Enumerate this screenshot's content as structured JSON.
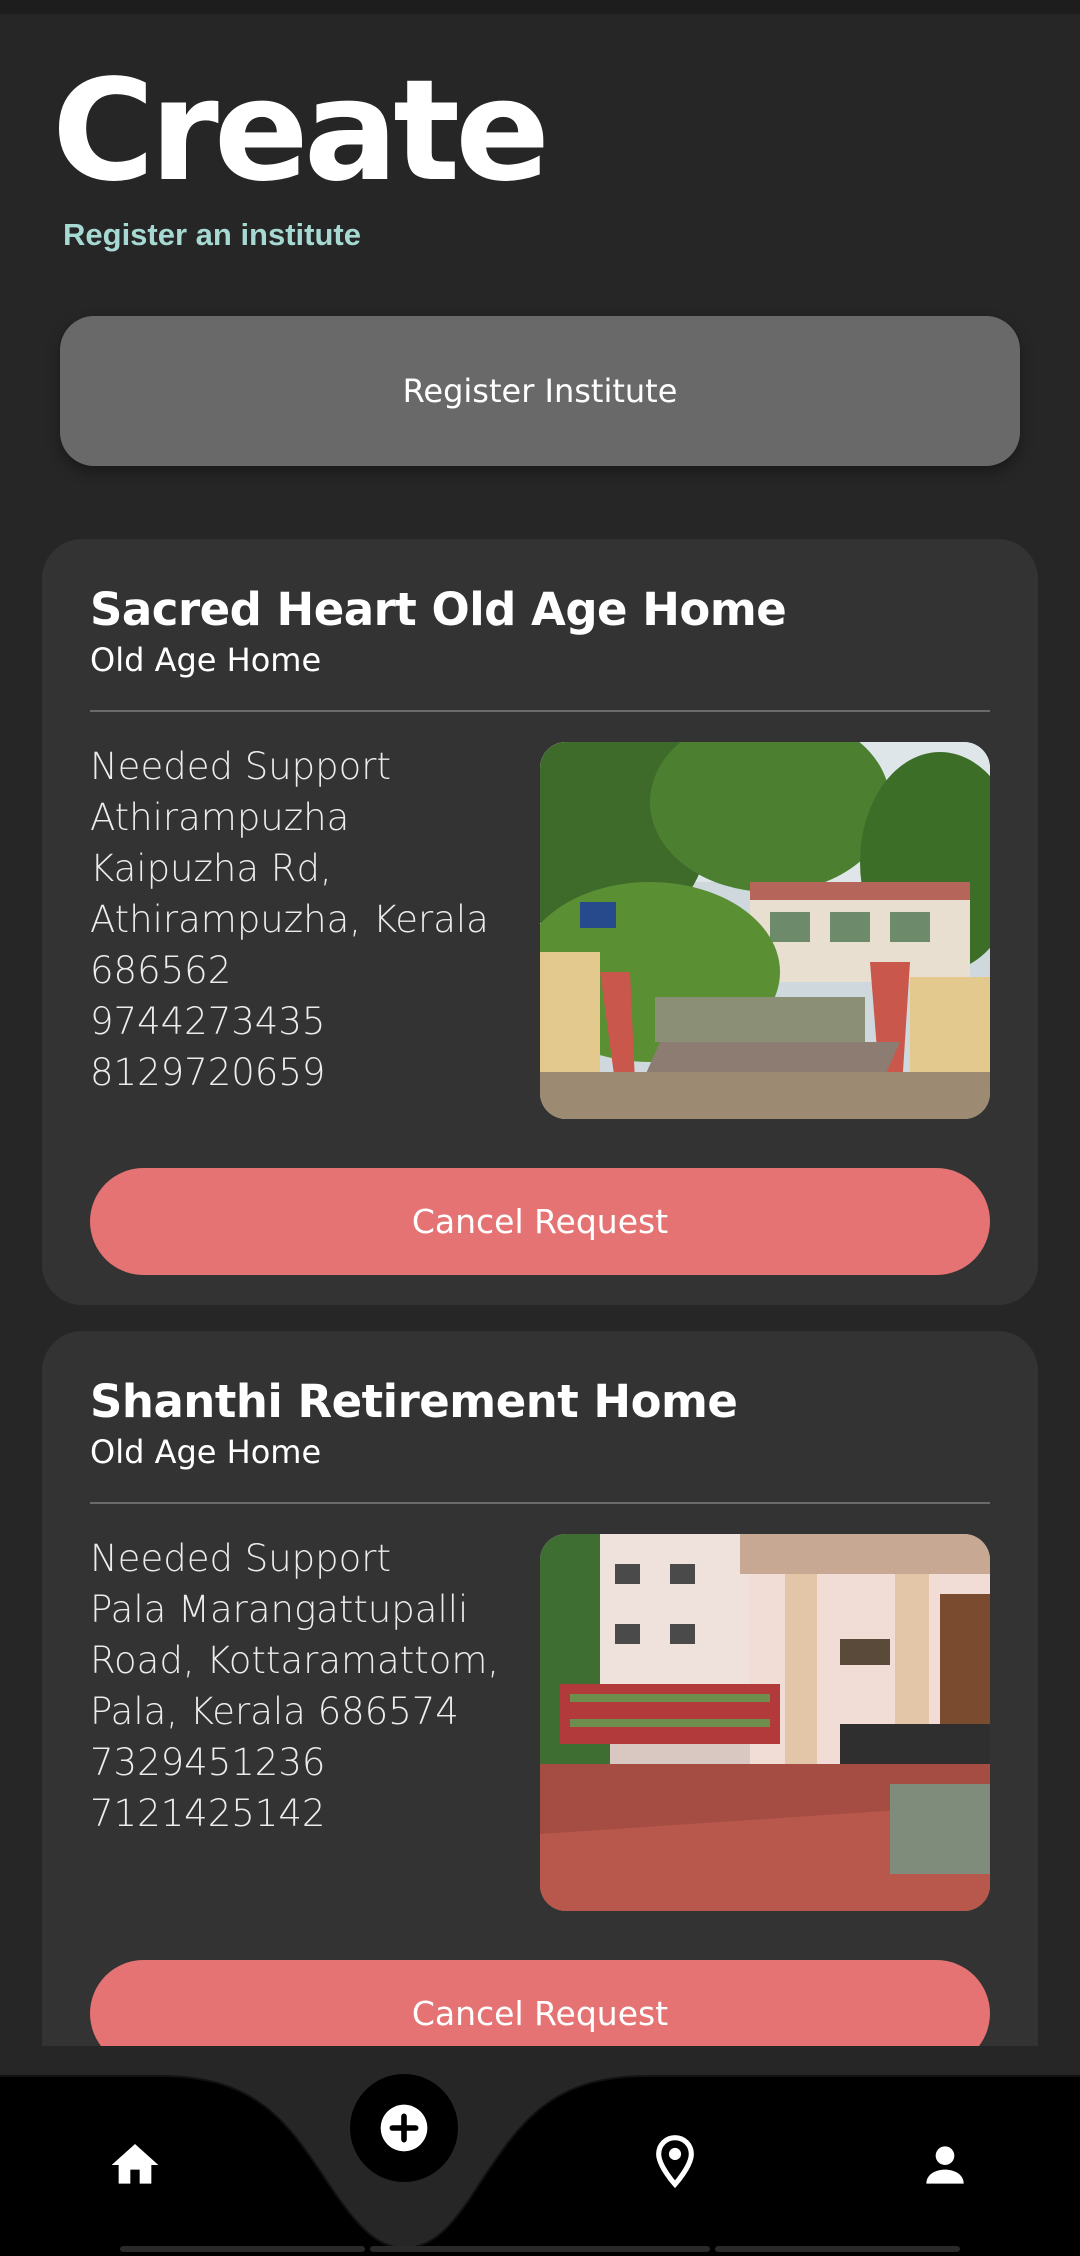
{
  "header": {
    "title": "Create",
    "subtitle": "Register an institute"
  },
  "register_button": {
    "label": "Register Institute"
  },
  "institutes": [
    {
      "name": "Sacred Heart Old Age Home",
      "type": "Old Age Home",
      "details": [
        "Needed Support",
        "Athirampuzha",
        "Kaipuzha Rd,",
        "Athirampuzha, Kerala",
        "686562",
        "9744273435",
        "8129720659"
      ],
      "cancel_label": "Cancel Request"
    },
    {
      "name": "Shanthi Retirement Home",
      "type": "Old Age Home",
      "details": [
        "Needed Support",
        "Pala Marangattupalli",
        "Road, Kottaramattom,",
        "Pala, Kerala 686574",
        "7329451236",
        "7121425142"
      ],
      "cancel_label": "Cancel Request"
    }
  ],
  "bottom_nav": {
    "items": [
      {
        "icon": "home-icon"
      },
      {
        "icon": "add-icon"
      },
      {
        "icon": "location-pin-icon"
      },
      {
        "icon": "person-icon"
      }
    ]
  },
  "colors": {
    "background": "#262626",
    "card": "#333333",
    "subtitle": "#a6d9d2",
    "register_button": "#696969",
    "cancel_button": "#e57373",
    "nav_bar": "#000000"
  }
}
